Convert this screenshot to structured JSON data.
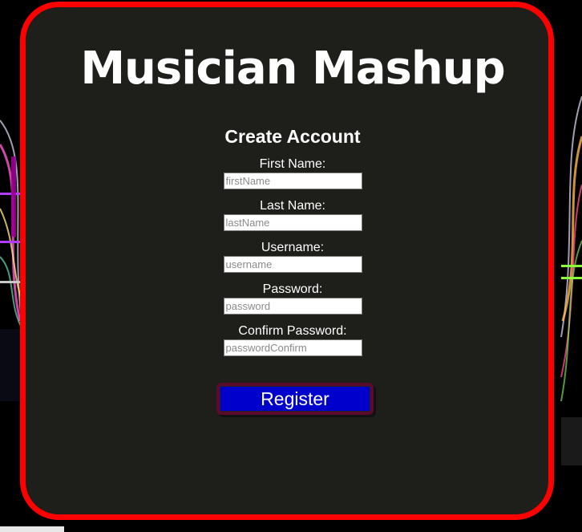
{
  "page": {
    "title": "Musician Mashup",
    "subtitle": "Create Account"
  },
  "form": {
    "fields": [
      {
        "label": "First Name:",
        "placeholder": "firstName",
        "value": ""
      },
      {
        "label": "Last Name:",
        "placeholder": "lastName",
        "value": ""
      },
      {
        "label": "Username:",
        "placeholder": "username",
        "value": ""
      },
      {
        "label": "Password:",
        "placeholder": "password",
        "value": ""
      },
      {
        "label": "Confirm Password:",
        "placeholder": "passwordConfirm",
        "value": ""
      }
    ],
    "submit_label": "Register"
  },
  "colors": {
    "panel_border": "#ff0000",
    "panel_background": "#1e1e1b",
    "button_background": "#0000cd",
    "text": "#ffffff"
  }
}
